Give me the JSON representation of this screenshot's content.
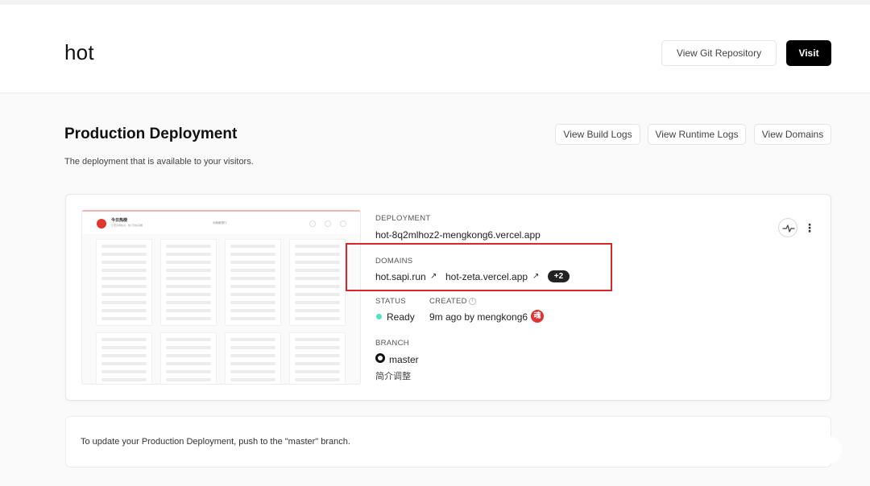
{
  "header": {
    "project_name": "hot",
    "git_button": "View Git Repository",
    "visit_button": "Visit"
  },
  "production": {
    "title": "Production Deployment",
    "description": "The deployment that is available to your visitors.",
    "buttons": {
      "build_logs": "View Build Logs",
      "runtime_logs": "View Runtime Logs",
      "domains": "View Domains"
    }
  },
  "deployment": {
    "label": "DEPLOYMENT",
    "url": "hot-8q2mlhoz2-mengkong6.vercel.app",
    "domains_label": "DOMAINS",
    "domains": [
      "hot.sapi.run",
      "hot-zeta.vercel.app"
    ],
    "more_domains": "+2",
    "status_label": "STATUS",
    "status": "Ready",
    "status_color": "#50e3c2",
    "created_label": "CREATED",
    "created": "9m ago by mengkong6",
    "avatar_text": "魂",
    "branch_label": "BRANCH",
    "branch": "master",
    "commit_message": "简介调整"
  },
  "preview": {
    "brand": "今日热榜",
    "brand_sub": "汇聚全网热点，热门尽在掌握",
    "center_text": "问我都很行"
  },
  "notice": {
    "text": "To update your Production Deployment, push to the \"master\" branch."
  },
  "colors": {
    "accent": "#000000",
    "highlight": "#d8262b"
  },
  "icons": {
    "external_link": "external-link-icon",
    "github": "github-icon",
    "activity": "activity-icon",
    "more": "more-vertical-icon",
    "info": "info-icon"
  }
}
